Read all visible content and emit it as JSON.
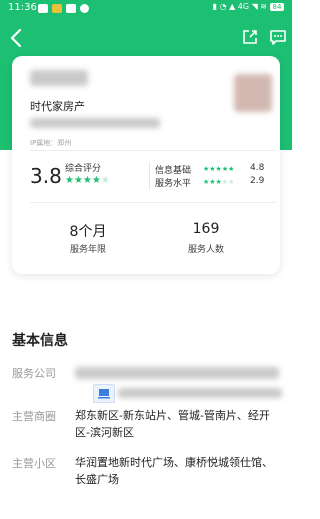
{
  "status_bar": {
    "time": "11:36",
    "battery": "84"
  },
  "nav": {
    "back_icon": "chevron-left-icon",
    "share_icon": "share-icon",
    "message_icon": "message-icon"
  },
  "profile": {
    "company": "时代家房产",
    "ip_location": "IP属地：郑州"
  },
  "rating": {
    "score": "3.8",
    "score_label": "综合评分",
    "stars_filled": 4,
    "items": [
      {
        "label": "信息基础",
        "value": "4.8",
        "stars": 5
      },
      {
        "label": "服务水平",
        "value": "2.9",
        "stars": 3
      }
    ]
  },
  "stats": [
    {
      "value": "8个月",
      "label": "服务年限"
    },
    {
      "value": "169",
      "label": "服务人数"
    }
  ],
  "basic_info": {
    "title": "基本信息",
    "rows": [
      {
        "label": "服务公司",
        "value": ""
      },
      {
        "label": "主营商圈",
        "value": "郑东新区-新东站片、管城-管南片、经开区-滨河新区"
      },
      {
        "label": "主营小区",
        "value": "华润置地新时代广场、康桥悦城领仕馆、长盛广场"
      }
    ]
  },
  "colors": {
    "accent": "#1dbf73"
  }
}
